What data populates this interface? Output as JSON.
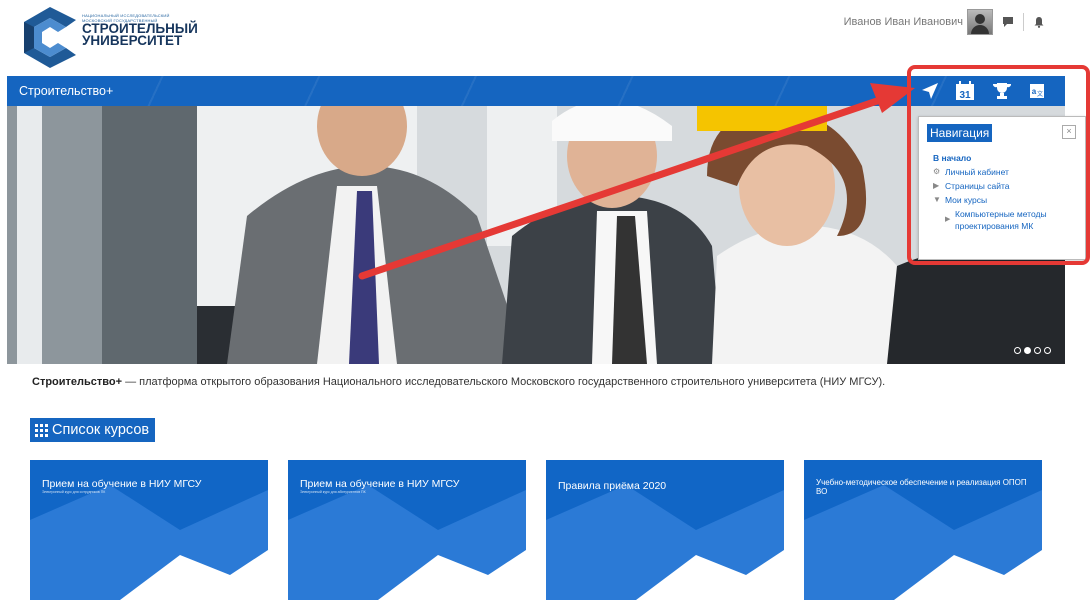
{
  "header": {
    "logo": {
      "line1": "НАЦИОНАЛЬНЫЙ ИССЛЕДОВАТЕЛЬСКИЙ",
      "line2": "МОСКОВСКИЙ ГОСУДАРСТВЕННЫЙ",
      "line3": "СТРОИТЕЛЬНЫЙ",
      "line4": "УНИВЕРСИТЕТ"
    },
    "user_name": "Иванов Иван Иванович",
    "icons": [
      "avatar",
      "messages-icon",
      "notifications-bell-icon"
    ]
  },
  "navbar": {
    "brand": "Строительство+",
    "icons": [
      "navigation-arrow-icon",
      "calendar-icon",
      "trophy-icon",
      "translate-icon"
    ],
    "calendar_day": "31"
  },
  "hero": {
    "slides": 4,
    "active_slide": 2
  },
  "nav_popup": {
    "title": "Навигация",
    "close": "×",
    "root": "В начало",
    "items": [
      {
        "label": "Личный кабинет"
      },
      {
        "label": "Страницы сайта"
      },
      {
        "label": "Мои курсы"
      }
    ],
    "sub_item": "Компьютерные методы проектирования МК"
  },
  "description": {
    "brand": "Строительство+",
    "text": " — платформа открытого образования Национального исследовательского Московского государственного строительного университета (НИУ МГСУ)."
  },
  "courses": {
    "heading": "Список курсов",
    "cards": [
      {
        "title": "Прием на обучение в НИУ МГСУ",
        "subtitle": "Электронный курс для сотрудников ПК"
      },
      {
        "title": "Прием на обучение в НИУ МГСУ",
        "subtitle": "Электронный курс для абитуриентов ПК"
      },
      {
        "title": "Правила приёма 2020",
        "subtitle": ""
      },
      {
        "title": "Учебно-методическое обеспечение и реализация ОПОП ВО",
        "subtitle": ""
      }
    ]
  },
  "colors": {
    "brand_blue": "#1565c0",
    "card_blue": "#1166c6",
    "annotation_red": "#e53935"
  }
}
